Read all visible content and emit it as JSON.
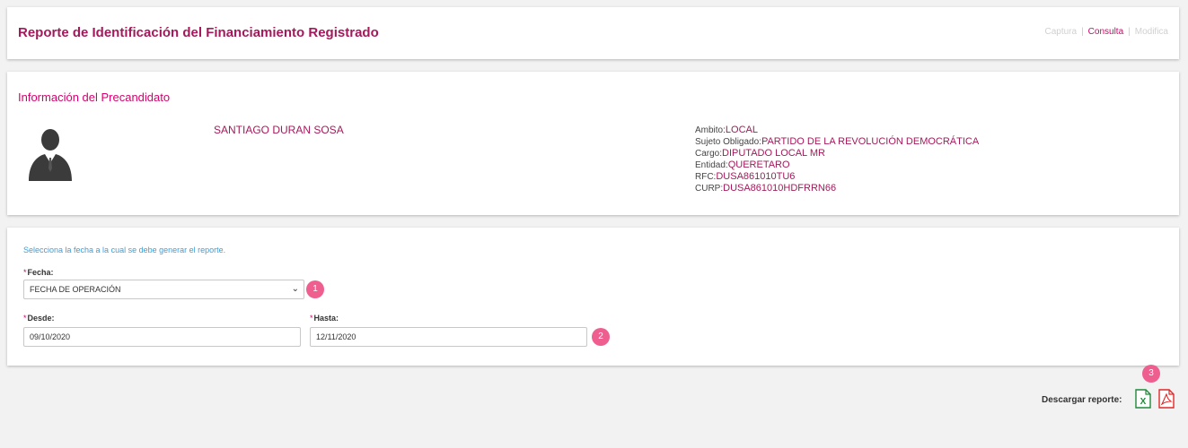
{
  "header": {
    "title": "Reporte de Identificación del Financiamiento Registrado",
    "nav": [
      {
        "label": "Captura",
        "active": false
      },
      {
        "label": "Consulta",
        "active": true
      },
      {
        "label": "Modifica",
        "active": false
      }
    ],
    "separator": "|"
  },
  "info": {
    "title": "Información del Precandidato",
    "avatar_icon": "user-silhouette-icon",
    "name": "SANTIAGO DURAN SOSA",
    "details": [
      {
        "label": "Ambito:",
        "value": "LOCAL"
      },
      {
        "label": "Sujeto Obligado:",
        "value": "PARTIDO DE LA REVOLUCIÓN DEMOCRÁTICA"
      },
      {
        "label": "Cargo:",
        "value": "DIPUTADO LOCAL MR"
      },
      {
        "label": "Entidad:",
        "value": "QUERETARO"
      },
      {
        "label": "RFC:",
        "value": "DUSA861010TU6"
      },
      {
        "label": "CURP:",
        "value": "DUSA861010HDFRRN66"
      }
    ]
  },
  "form": {
    "instructions": "Selecciona la fecha a la cual se debe generar el reporte.",
    "required_mark": "*",
    "fecha_label": "Fecha:",
    "fecha_value": "FECHA DE OPERACIÓN",
    "desde_label": "Desde:",
    "desde_value": "09/10/2020",
    "hasta_label": "Hasta:",
    "hasta_value": "12/11/2020",
    "step_badges": [
      "1",
      "2",
      "3"
    ]
  },
  "download": {
    "label": "Descargar reporte:",
    "excel_icon": "excel-file-icon",
    "excel_letter": "X",
    "pdf_icon": "pdf-file-icon"
  },
  "colors": {
    "brand": "#a3195b",
    "accent": "#d5006d",
    "badge": "#ee5f8f",
    "link_blue": "#3c9ed8",
    "excel_green": "#1f8a3a",
    "pdf_red": "#e02828"
  }
}
